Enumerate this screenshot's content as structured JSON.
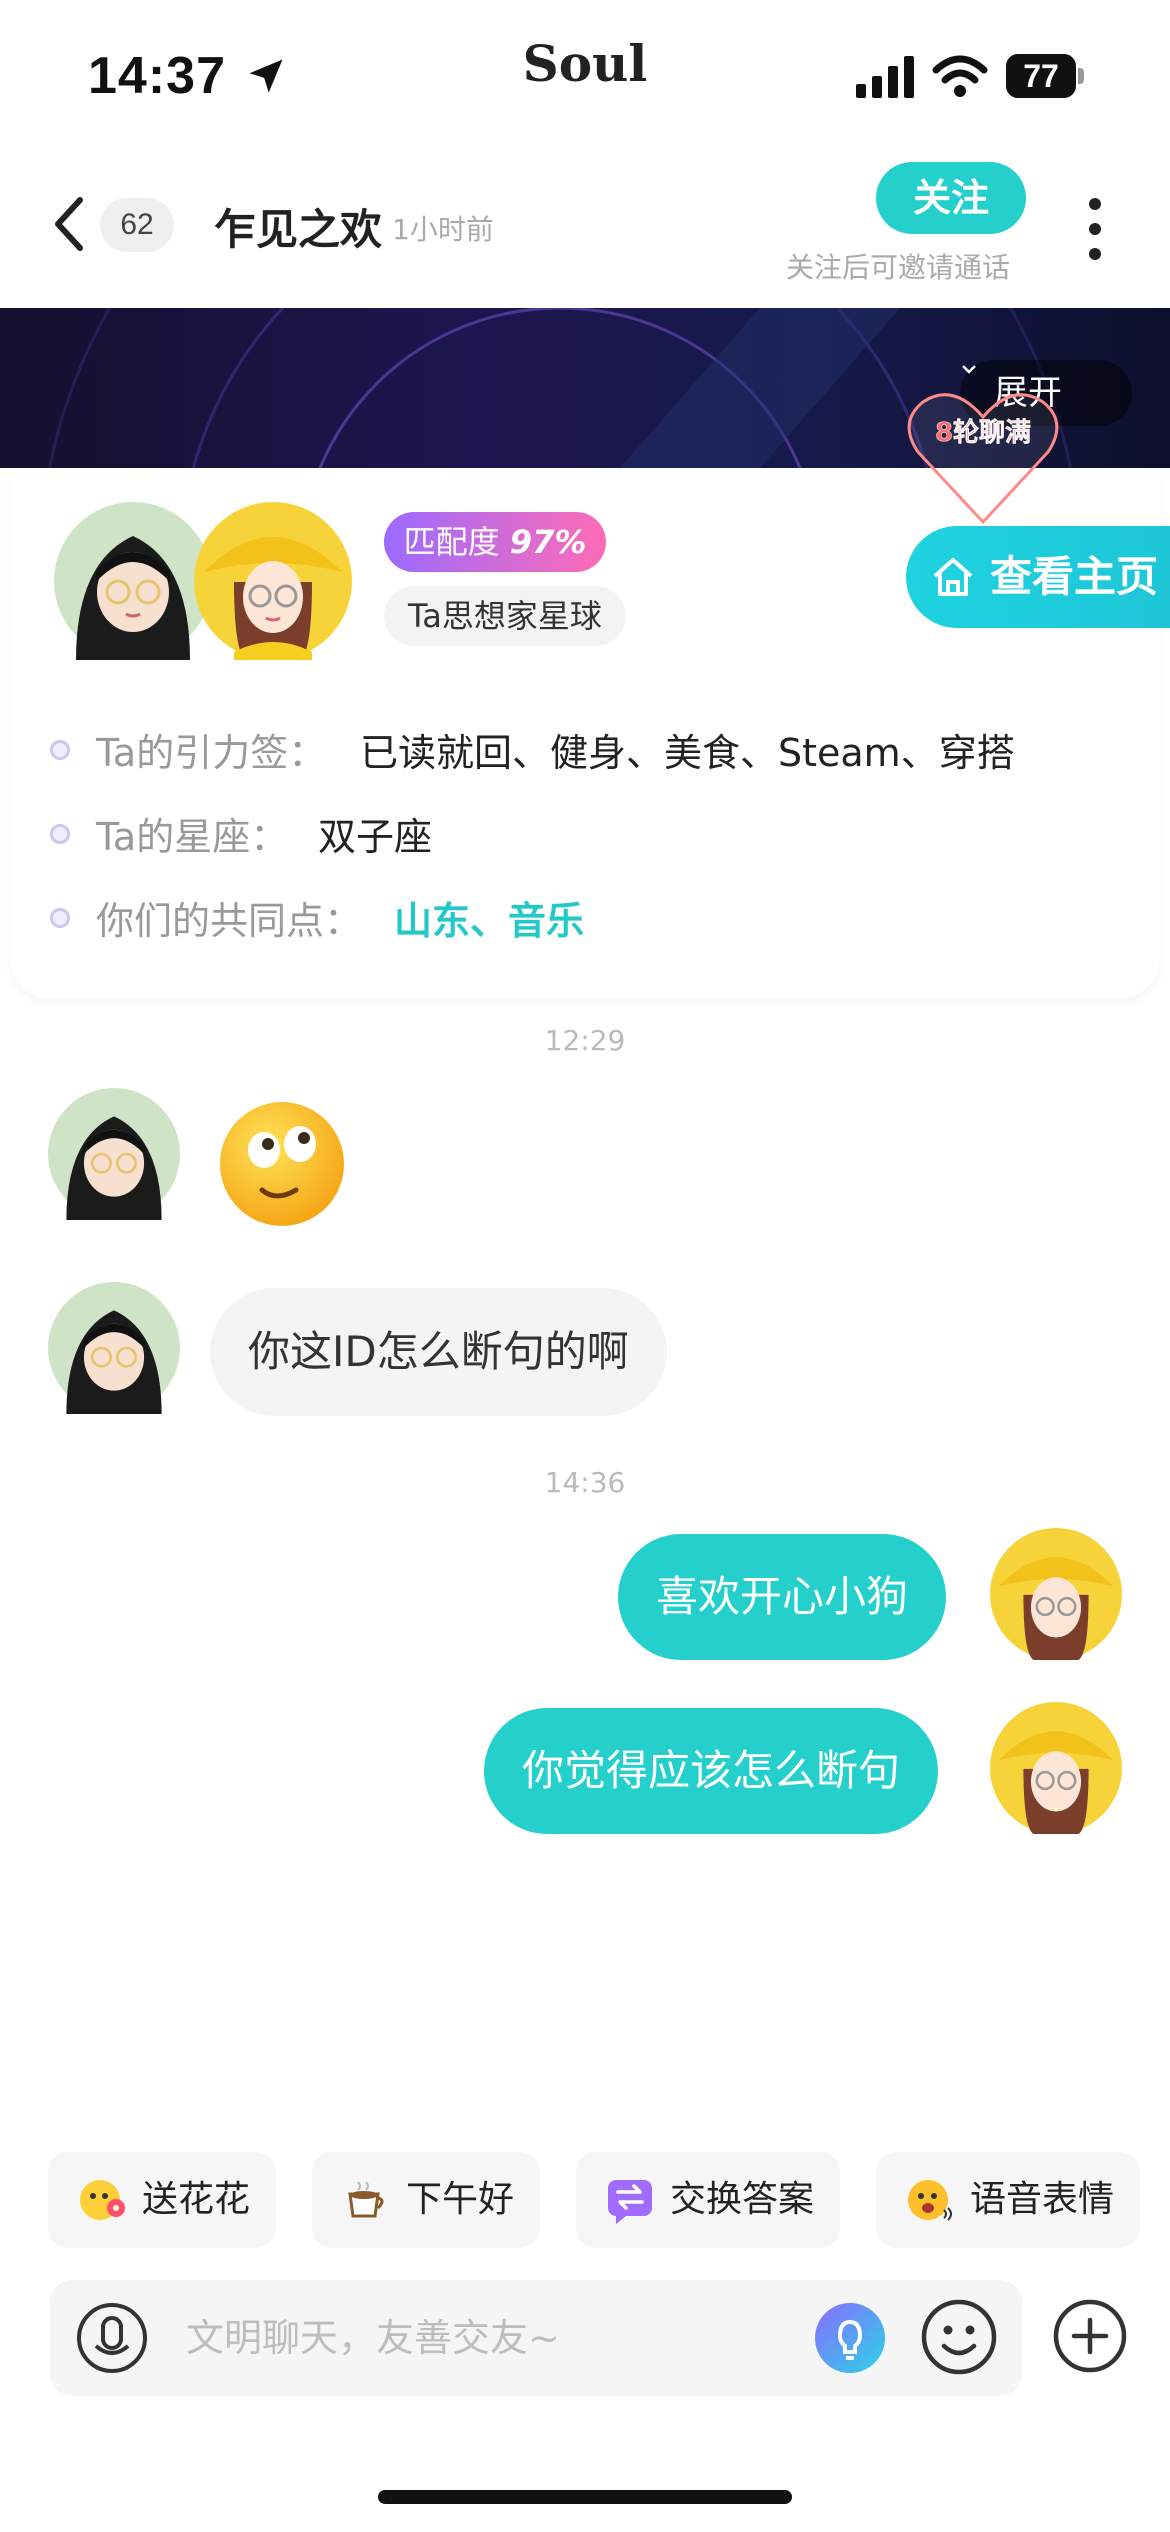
{
  "status_bar": {
    "time": "14:37",
    "app_name": "Soul",
    "battery": "77"
  },
  "header": {
    "unread_count": "62",
    "contact_name": "乍见之欢",
    "last_seen": "1小时前",
    "follow_label": "关注",
    "follow_hint": "关注后可邀请通话"
  },
  "banner": {
    "expand_label": "展开"
  },
  "profile": {
    "heart_badge": "8轮聊满",
    "match_prefix": "匹配度",
    "match_value": "97%",
    "planet_tag": "Ta思想家星球",
    "view_home_label": "查看主页",
    "info": [
      {
        "label": "Ta的引力签：",
        "value": "已读就回、健身、美食、Steam、穿搭"
      },
      {
        "label": "Ta的星座：",
        "value": "双子座"
      },
      {
        "label": "你们的共同点：",
        "value": "山东、音乐"
      }
    ]
  },
  "chat": {
    "timestamps": [
      "12:29",
      "14:36"
    ],
    "messages": [
      {
        "from": "other",
        "type": "sticker",
        "icon": "rolling-eyes-emoji"
      },
      {
        "from": "other",
        "type": "text",
        "text": "你这ID怎么断句的啊"
      },
      {
        "from": "me",
        "type": "text",
        "text": "喜欢开心小狗"
      },
      {
        "from": "me",
        "type": "text",
        "text": "你觉得应该怎么断句"
      }
    ]
  },
  "quick_actions": [
    {
      "label": "送花花",
      "icon": "flower-emoji-icon"
    },
    {
      "label": "下午好",
      "icon": "coffee-icon"
    },
    {
      "label": "交换答案",
      "icon": "exchange-icon"
    },
    {
      "label": "语音表情",
      "icon": "voice-emoji-icon"
    }
  ],
  "input": {
    "placeholder": "文明聊天，友善交友~",
    "value": ""
  },
  "colors": {
    "accent": "#25d0cc",
    "match_gradient_start": "#9a6bff",
    "match_gradient_end": "#ff6bb5",
    "bubble_in": "#f4f4f4"
  }
}
